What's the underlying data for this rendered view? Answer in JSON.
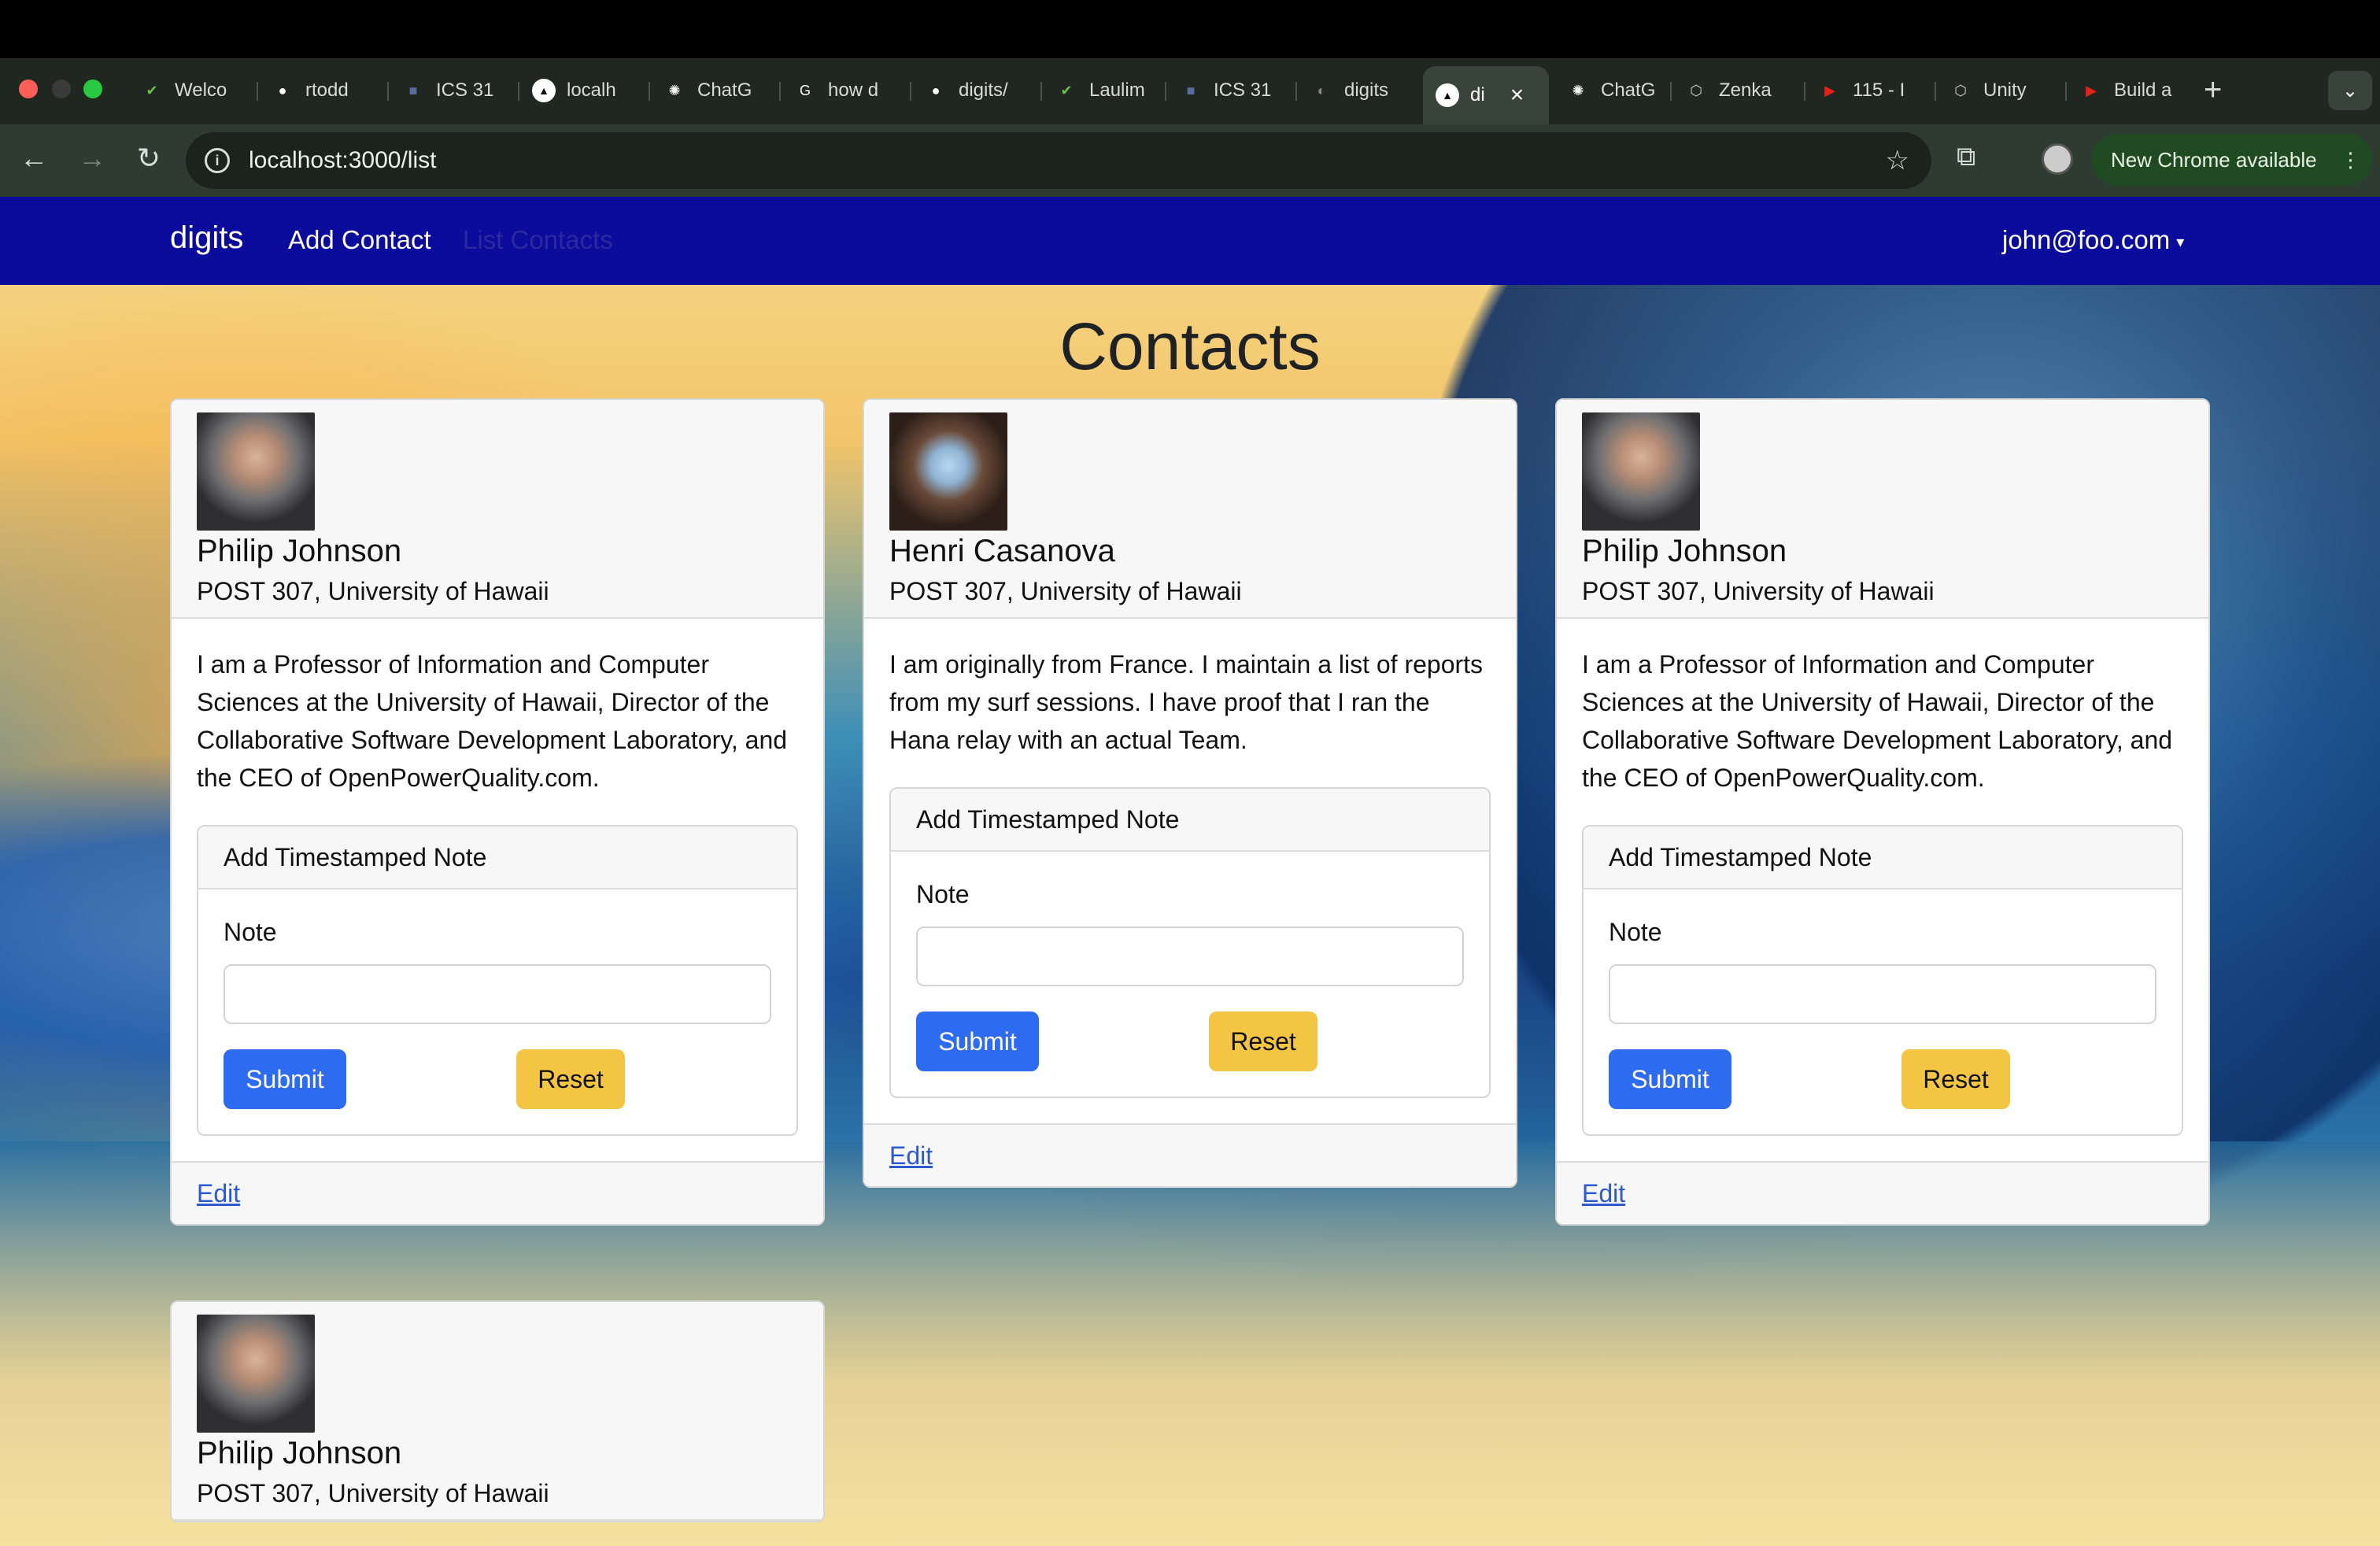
{
  "browser": {
    "tabs": [
      {
        "label": "Welco",
        "icon": "leaf-icon",
        "color": "#6abf4b"
      },
      {
        "label": "rtodd",
        "icon": "github-icon",
        "color": "#ffffff"
      },
      {
        "label": "ICS 31",
        "icon": "square-icon",
        "color": "#5a6a9a"
      },
      {
        "label": "localh",
        "icon": "triangle-icon",
        "color": "#000000"
      },
      {
        "label": "ChatG",
        "icon": "chatgpt-icon",
        "color": "#ffffff"
      },
      {
        "label": "how d",
        "icon": "google-icon",
        "color": "#ffffff"
      },
      {
        "label": "digits/",
        "icon": "github-icon",
        "color": "#ffffff"
      },
      {
        "label": "Laulim",
        "icon": "leaf-icon",
        "color": "#6abf4b"
      },
      {
        "label": "ICS 31",
        "icon": "square-icon",
        "color": "#5a6a9a"
      },
      {
        "label": "digits",
        "icon": "globe-icon",
        "color": "#888888"
      },
      {
        "label": "di",
        "icon": "triangle-icon",
        "color": "#000000",
        "active": true
      },
      {
        "label": "ChatG",
        "icon": "chatgpt-icon",
        "color": "#ffffff"
      },
      {
        "label": "Zenka",
        "icon": "unity-icon",
        "color": "#cccccc"
      },
      {
        "label": "115 - I",
        "icon": "youtube-icon",
        "color": "#e62117"
      },
      {
        "label": "Unity",
        "icon": "unity-icon",
        "color": "#cccccc"
      },
      {
        "label": "Build a",
        "icon": "youtube-icon",
        "color": "#e62117"
      }
    ],
    "url": "localhost:3000/list",
    "update_label": "New Chrome available"
  },
  "navbar": {
    "brand": "digits",
    "add_contact": "Add Contact",
    "list_contacts": "List Contacts",
    "user": "john@foo.com"
  },
  "page_title": "Contacts",
  "note_form": {
    "header": "Add Timestamped Note",
    "label": "Note",
    "value": "",
    "submit": "Submit",
    "reset": "Reset"
  },
  "edit_label": "Edit",
  "contacts": [
    {
      "name": "Philip Johnson",
      "address": "POST 307, University of Hawaii",
      "description": "I am a Professor of Information and Computer Sciences at the University of Hawaii, Director of the Collaborative Software Development Laboratory, and the CEO of OpenPowerQuality.com."
    },
    {
      "name": "Henri Casanova",
      "address": "POST 307, University of Hawaii",
      "description": "I am originally from France. I maintain a list of reports from my surf sessions. I have proof that I ran the Hana relay with an actual Team."
    },
    {
      "name": "Philip Johnson",
      "address": "POST 307, University of Hawaii",
      "description": "I am a Professor of Information and Computer Sciences at the University of Hawaii, Director of the Collaborative Software Development Laboratory, and the CEO of OpenPowerQuality.com."
    },
    {
      "name": "Philip Johnson",
      "address": "POST 307, University of Hawaii"
    }
  ]
}
